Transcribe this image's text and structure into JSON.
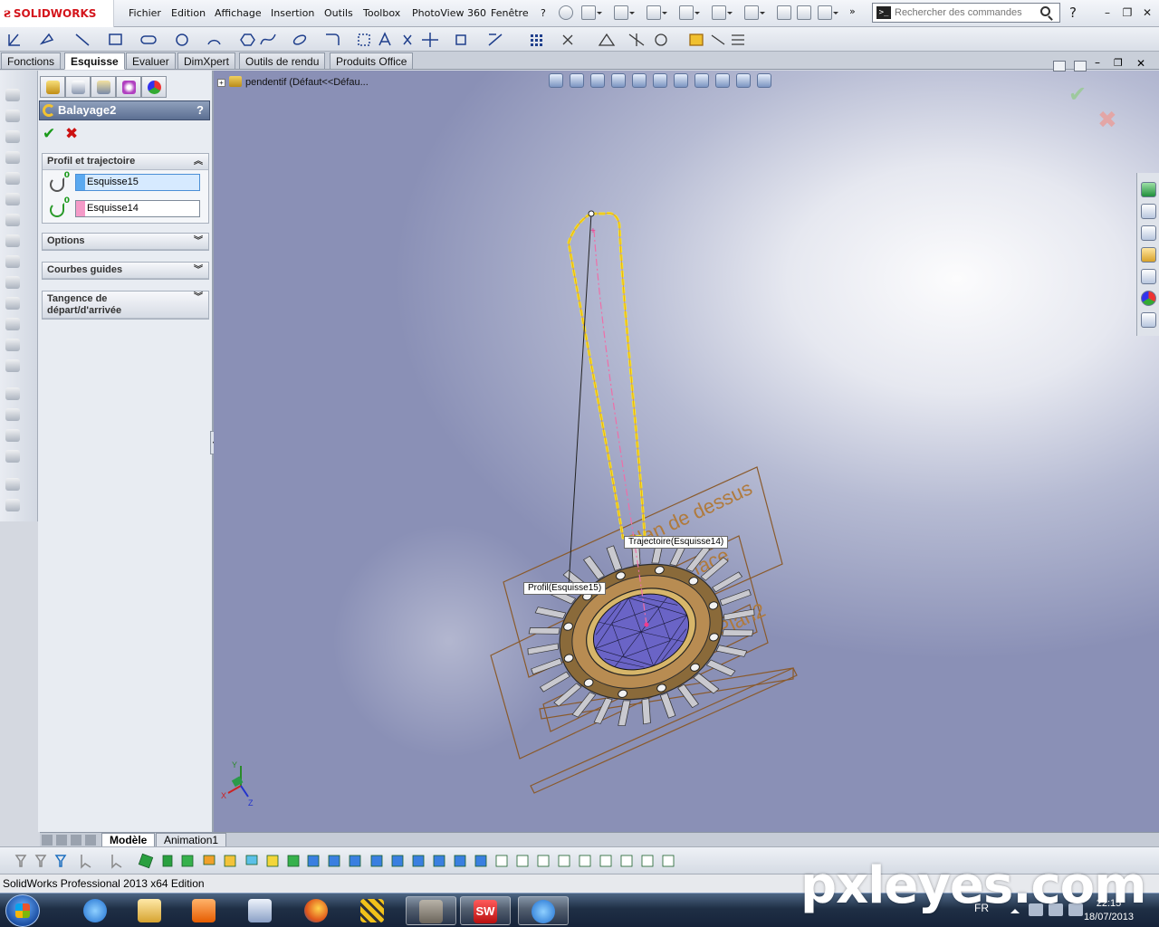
{
  "app": {
    "brand": "SOLIDWORKS",
    "menus": [
      "Fichier",
      "Edition",
      "Affichage",
      "Insertion",
      "Outils",
      "Toolbox",
      "PhotoView 360",
      "Fenêtre",
      "?"
    ],
    "search_placeholder": "Rechercher des commandes",
    "help_label": "?"
  },
  "command_tabs": [
    "Fonctions",
    "Esquisse",
    "Evaluer",
    "DimXpert",
    "Outils de rendu",
    "Produits Office"
  ],
  "active_tab": "Esquisse",
  "property_manager": {
    "title": "Balayage2",
    "help": "?",
    "ok_symbol": "✔",
    "cancel_symbol": "✖",
    "group_profile": "Profil et trajectoire",
    "profile_field": "Esquisse15",
    "path_field": "Esquisse14",
    "profile_color": "#5aa9f0",
    "path_color": "#f49ac8",
    "group_options": "Options",
    "group_guides": "Courbes guides",
    "group_tangency": "Tangence de départ/d'arrivée"
  },
  "tree": {
    "root_label": "pendentif  (Défaut<<Défau..."
  },
  "viewport": {
    "callout_path": "Trajectoire(Esquisse14)",
    "callout_profile": "Profil(Esquisse15)",
    "plane_top": "Plan de dessus",
    "plane_face": "Plan de face",
    "plane_2": "Plan2",
    "axis_x": "X",
    "axis_y": "Y",
    "axis_z": "Z"
  },
  "bottom_tabs": [
    "Modèle",
    "Animation1"
  ],
  "status": {
    "text": "SolidWorks Professional 2013 x64 Edition"
  },
  "taskbar": {
    "lang": "FR",
    "time": "22:15",
    "date": "18/07/2013"
  },
  "watermark": "pxleyes.com"
}
